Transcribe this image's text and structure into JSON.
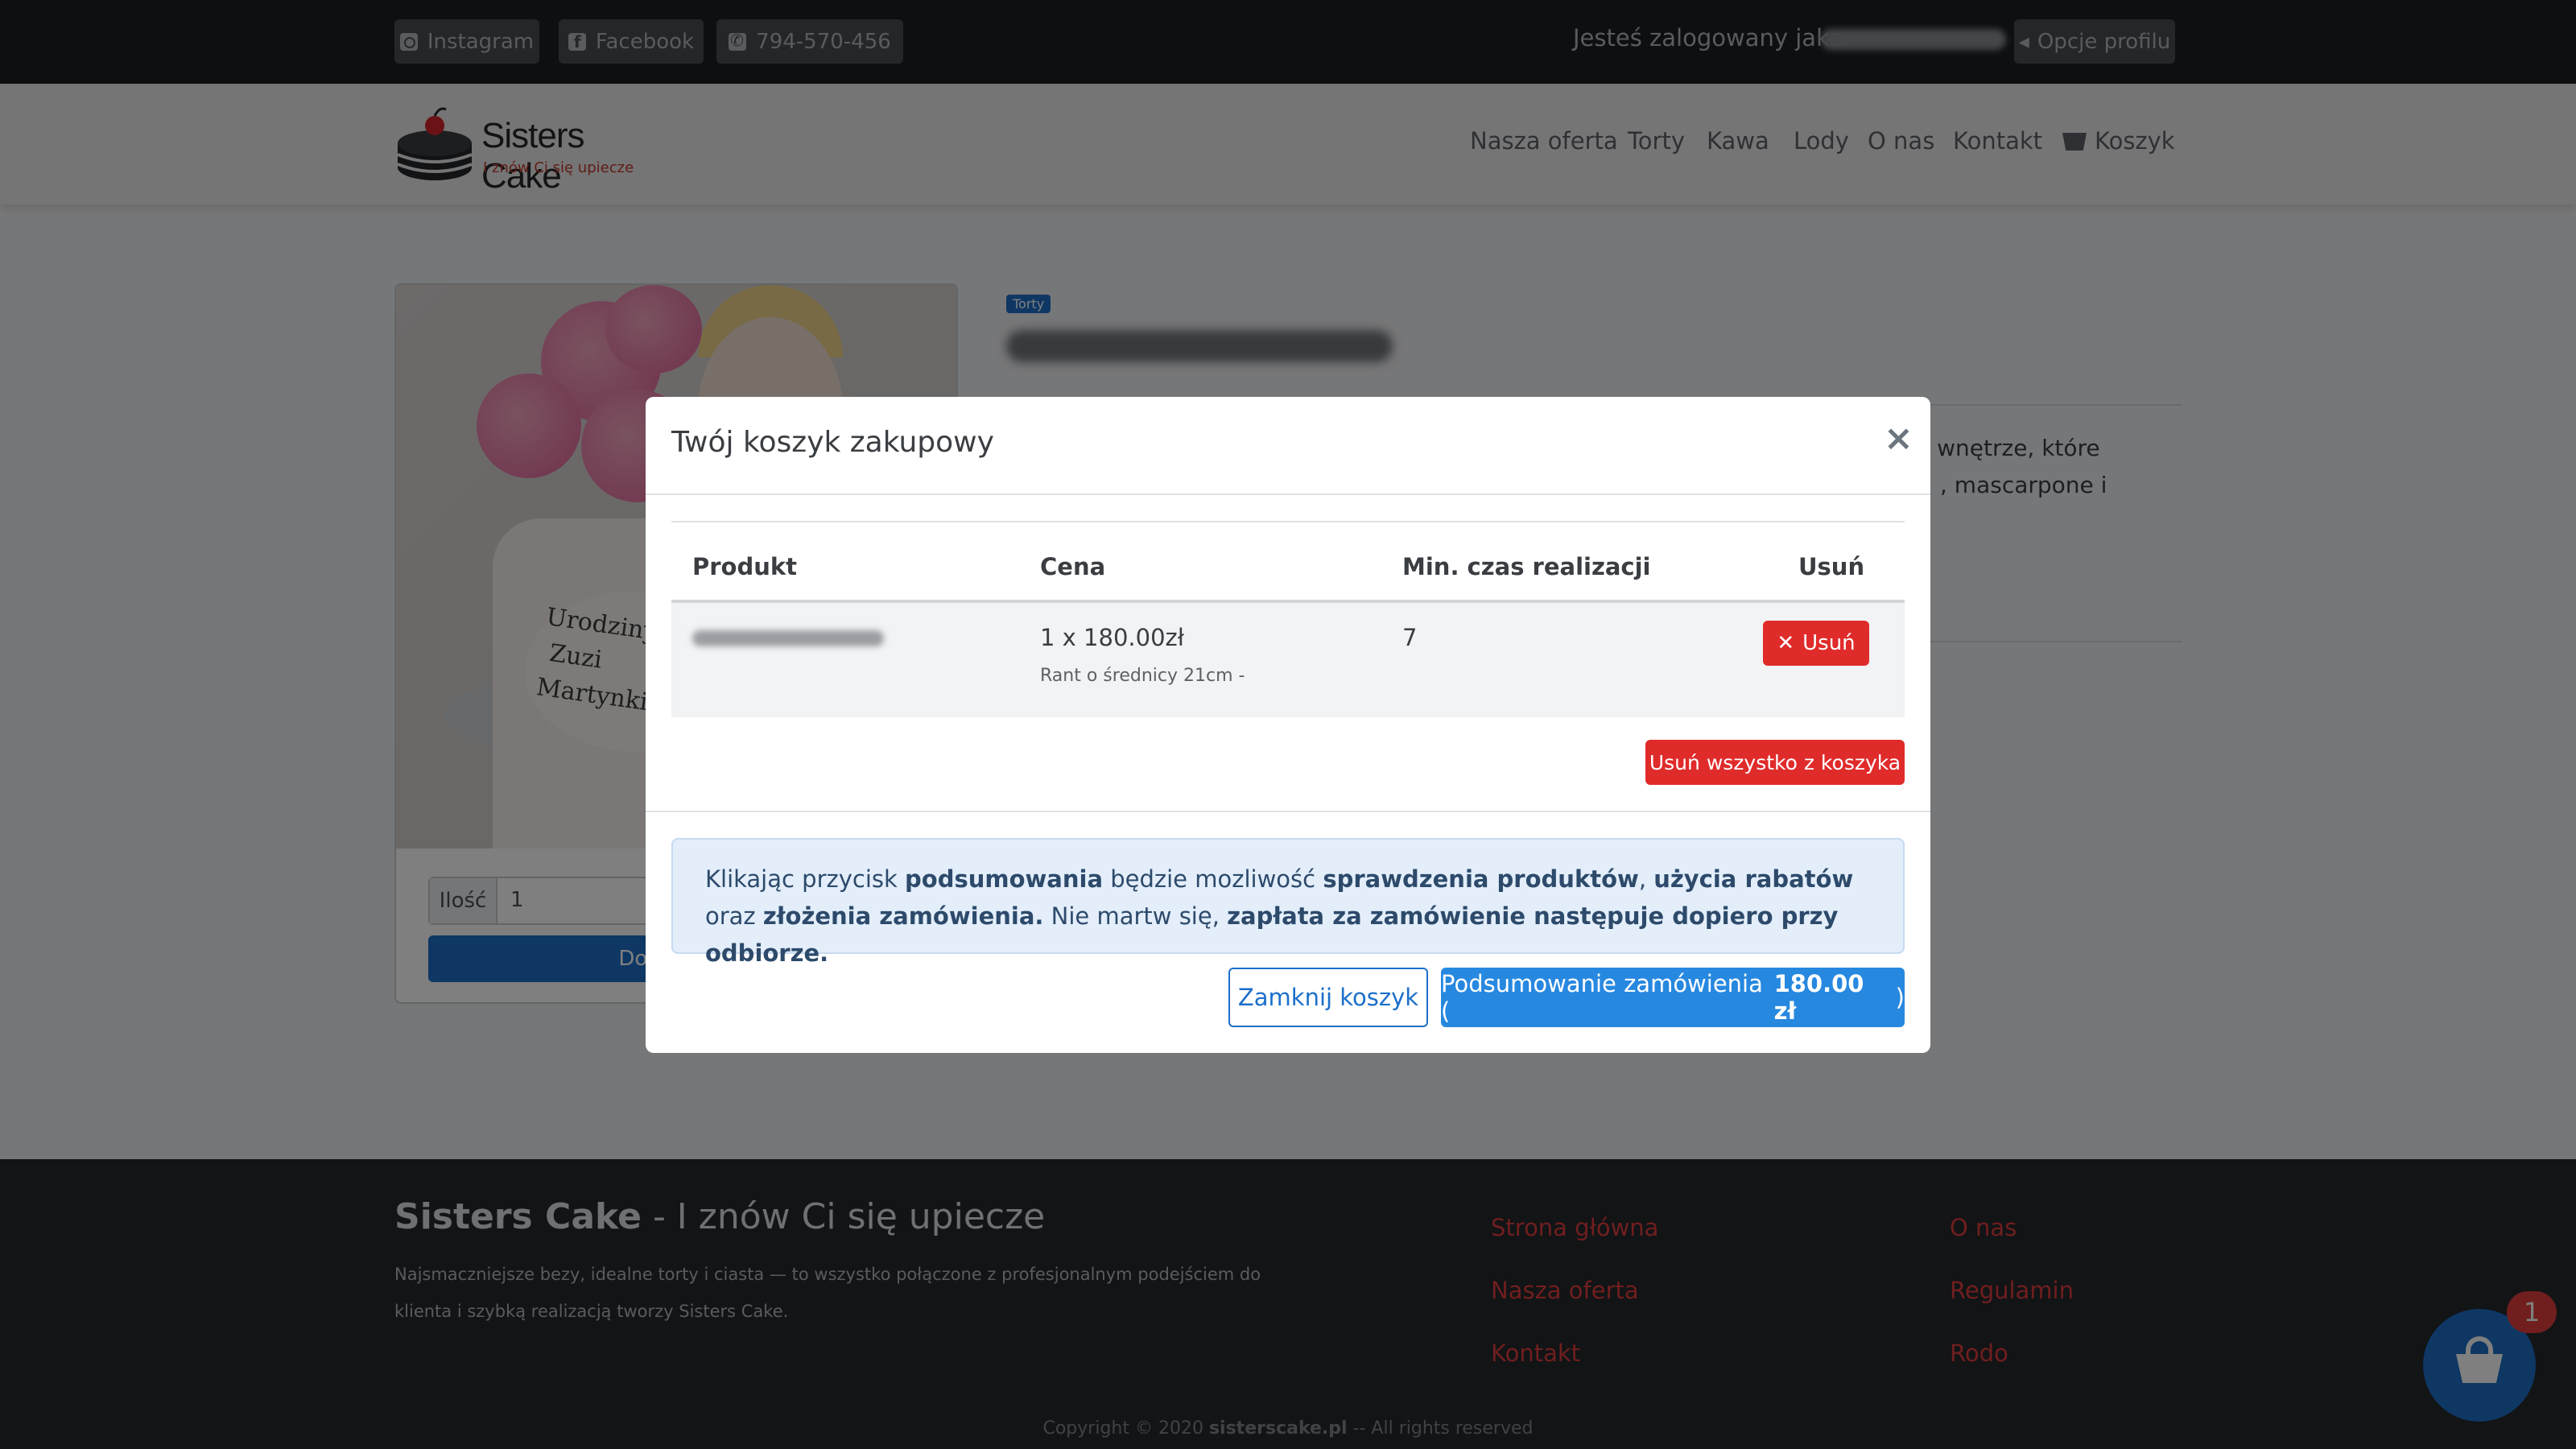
{
  "topbar": {
    "instagram_label": "Instagram",
    "facebook_label": "Facebook",
    "phone_label": "794-570-456",
    "logged_in_text": "Jesteś zalogowany jako",
    "profile_options_label": "Opcje profilu"
  },
  "brand": {
    "name": "Sisters Cake",
    "tagline": "I znów Ci się upiecze"
  },
  "nav": {
    "items": [
      {
        "label": "Nasza oferta"
      },
      {
        "label": "Torty"
      },
      {
        "label": "Kawa"
      },
      {
        "label": "Lody"
      },
      {
        "label": "O nas"
      },
      {
        "label": "Kontakt"
      },
      {
        "label": "Koszyk"
      }
    ]
  },
  "product": {
    "category_badge": "Torty",
    "image_text": [
      "Urodziny",
      "Zuzi",
      "Martynki"
    ],
    "quantity_label": "Ilość",
    "quantity_value": "1",
    "add_to_cart_label": "Do koszyka",
    "description_line1": "e wnętrze, które",
    "description_line2": ", mascarpone i"
  },
  "modal": {
    "title": "Twój koszyk zakupowy",
    "close_symbol": "×",
    "table": {
      "headers": [
        "Produkt",
        "Cena",
        "Min. czas realizacji",
        "Usuń"
      ],
      "rows": [
        {
          "price": "1 x 180.00zł",
          "variant": "Rant o średnicy 21cm -",
          "min_time": "7",
          "delete_label": "Usuń"
        }
      ]
    },
    "delete_all_label": "Usuń wszystko z koszyka",
    "info": {
      "p1": "Klikając przycisk ",
      "b1": "podsumowania",
      "p2": " będzie mozliwość ",
      "b2": "sprawdzenia produktów",
      "p3": ", ",
      "b3": "użycia rabatów",
      "p4": " oraz ",
      "b4": "złożenia zamówienia.",
      "p5": " Nie martw się, ",
      "b5": "zapłata za zamówienie następuje dopiero przy odbiorze."
    },
    "close_cart_label": "Zamknij koszyk",
    "summary_label": "Podsumowanie zamówienia (",
    "summary_amount": "180.00 zł",
    "summary_suffix": ")"
  },
  "footer": {
    "brand": "Sisters Cake",
    "tagline": " - I znów Ci się upiecze",
    "description": "Najsmaczniejsze bezy, idealne torty i ciasta — to wszystko połączone z profesjonalnym podejściem do klienta i szybką realizacją tworzy Sisters Cake.",
    "links_col1": [
      "Strona główna",
      "Nasza oferta",
      "Kontakt"
    ],
    "links_col2": [
      "O nas",
      "Regulamin",
      "Rodo"
    ],
    "copyright_prefix": "Copyright © 2020 ",
    "copyright_site": "sisterscake.pl",
    "copyright_suffix": " -- All rights reserved"
  },
  "cart_fab": {
    "count": "1"
  },
  "colors": {
    "primary": "#2788e0",
    "danger": "#e02b2b",
    "dark": "#1c1f23",
    "footer_link": "#e03c3c"
  }
}
